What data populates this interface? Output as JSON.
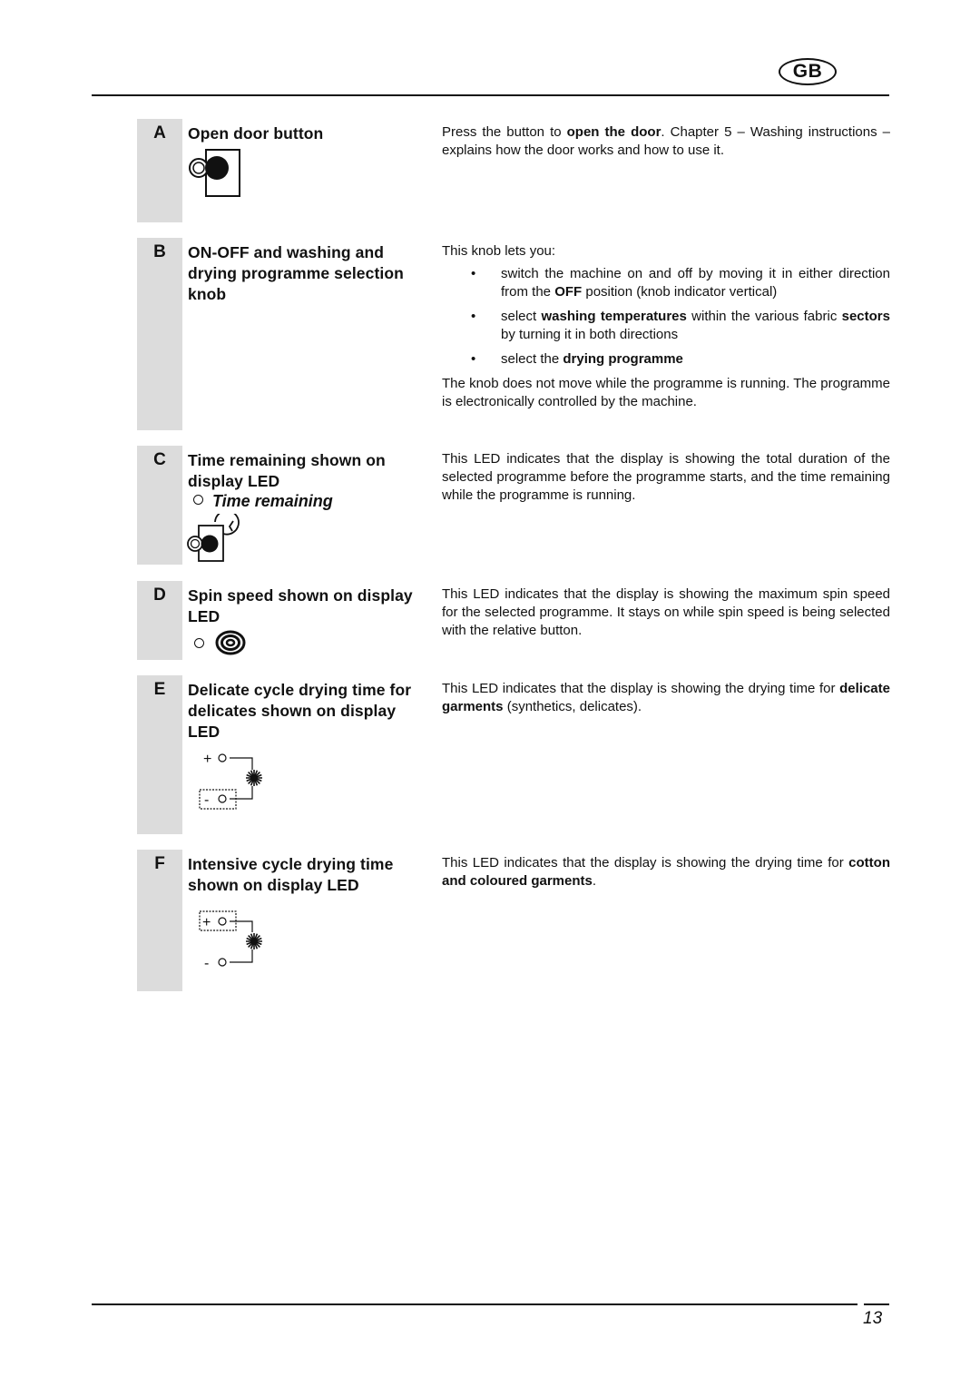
{
  "header": {
    "badge": "GB"
  },
  "footer": {
    "page_number": "13"
  },
  "sections": [
    {
      "letter": "A",
      "title": "Open door button",
      "icon": "door-button-icon",
      "description": [
        {
          "t": "Press the button to "
        },
        {
          "b": "open the door"
        },
        {
          "t": ". Chapter 5 – Washing instructions – explains how the door works and how to use it."
        }
      ]
    },
    {
      "letter": "B",
      "title": "ON-OFF and washing and drying programme selection knob",
      "intro": "This knob lets you:",
      "bullets": [
        [
          {
            "t": "switch the machine on and off by moving it in either direction from the "
          },
          {
            "b": "OFF"
          },
          {
            "t": " position (knob indicator vertical)"
          }
        ],
        [
          {
            "t": "select "
          },
          {
            "b": "washing temperatures"
          },
          {
            "t": " within the various fabric "
          },
          {
            "b": "sectors"
          },
          {
            "t": " by turning it in both directions"
          }
        ],
        [
          {
            "t": "select the "
          },
          {
            "b": "drying programme"
          }
        ]
      ],
      "outro": "The knob does not move while the programme is running. The programme is electronically controlled by the machine."
    },
    {
      "letter": "C",
      "title": "Time remaining shown on display LED",
      "sublabel": "Time remaining",
      "icon": "time-remaining-icon",
      "description": [
        {
          "t": "This LED indicates that the display is showing the total duration of the selected programme before the programme starts, and the time remaining while the programme is running."
        }
      ]
    },
    {
      "letter": "D",
      "title": "Spin speed shown on display LED",
      "icon": "spin-spiral-icon",
      "description": [
        {
          "t": "This LED indicates that the display is showing the maximum spin speed for the selected programme. It stays on while spin speed is being selected with the relative button."
        }
      ]
    },
    {
      "letter": "E",
      "title": "Delicate cycle drying time for delicates shown on display LED",
      "icon": "delicate-drying-led-icon",
      "plus_label": "+",
      "minus_label": "-",
      "description": [
        {
          "t": "This LED indicates that the display is showing the drying time for "
        },
        {
          "b": "delicate garments"
        },
        {
          "t": " (synthetics, delicates)."
        }
      ]
    },
    {
      "letter": "F",
      "title": "Intensive cycle drying time shown on display LED",
      "icon": "intensive-drying-led-icon",
      "plus_label": "+",
      "minus_label": "-",
      "description": [
        {
          "t": "This LED indicates that the display is showing the drying time for "
        },
        {
          "b": "cotton and coloured garments"
        },
        {
          "t": "."
        }
      ]
    }
  ]
}
